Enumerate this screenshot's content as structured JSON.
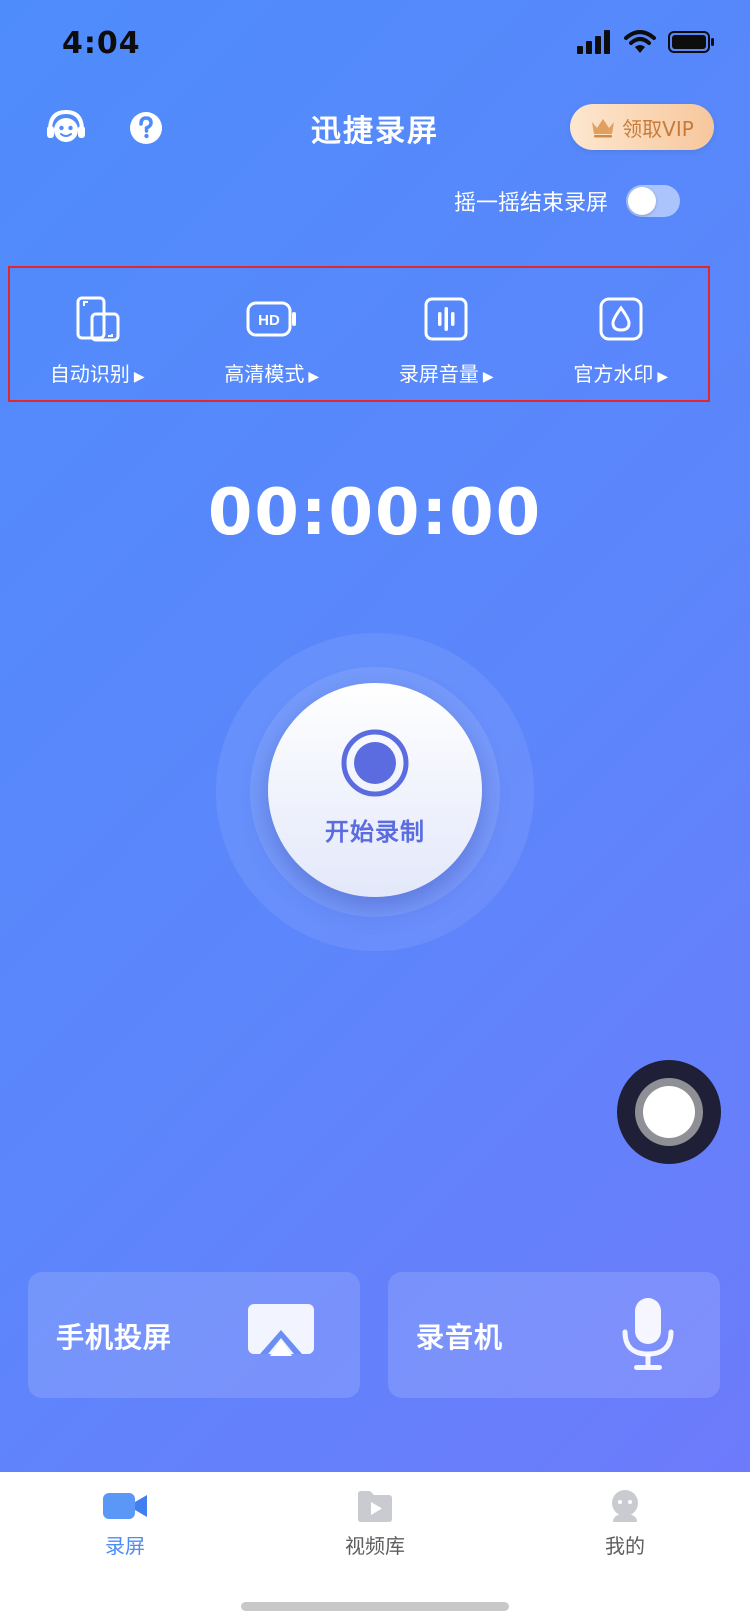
{
  "status": {
    "time": "4:04"
  },
  "header": {
    "title": "迅捷录屏",
    "support_icon": "headset-robot-icon",
    "help_icon": "question-icon",
    "vip_label": "领取VIP",
    "vip_icon": "crown-icon"
  },
  "shake": {
    "label": "摇一摇结束录屏",
    "enabled": false
  },
  "modes": [
    {
      "label": "自动识别",
      "icon": "orientation-icon"
    },
    {
      "label": "高清模式",
      "icon": "hd-icon"
    },
    {
      "label": "录屏音量",
      "icon": "volume-icon"
    },
    {
      "label": "官方水印",
      "icon": "watermark-drop-icon"
    }
  ],
  "timer": "00:00:00",
  "record": {
    "label": "开始录制"
  },
  "cards": [
    {
      "label": "手机投屏",
      "icon": "airplay-icon"
    },
    {
      "label": "录音机",
      "icon": "microphone-icon"
    }
  ],
  "tabs": [
    {
      "label": "录屏",
      "icon": "video-camera-icon",
      "active": true
    },
    {
      "label": "视频库",
      "icon": "folder-play-icon",
      "active": false
    },
    {
      "label": "我的",
      "icon": "user-icon",
      "active": false
    }
  ],
  "colors": {
    "accent": "#4d8cf5",
    "bg_start": "#4f8cfb",
    "bg_end": "#6d7bfb",
    "highlight_border": "#e0272b"
  }
}
